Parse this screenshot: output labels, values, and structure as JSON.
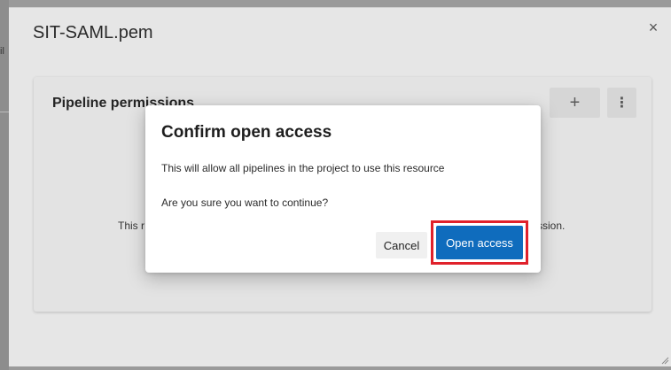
{
  "background": {
    "peek_text": "il"
  },
  "panel": {
    "title": "SIT-SAML.pem",
    "close_glyph": "×"
  },
  "card": {
    "title": "Pipeline permissions",
    "add_glyph": "+",
    "more_glyph": "⋮",
    "body_text_left": "This r",
    "body_text_right": "ssion."
  },
  "dialog": {
    "title": "Confirm open access",
    "message": "This will allow all pipelines in the project to use this resource",
    "confirm_question": "Are you sure you want to continue?",
    "cancel_label": "Cancel",
    "primary_label": "Open access"
  },
  "colors": {
    "primary": "#0f6cbd",
    "highlight": "#e0212b"
  }
}
